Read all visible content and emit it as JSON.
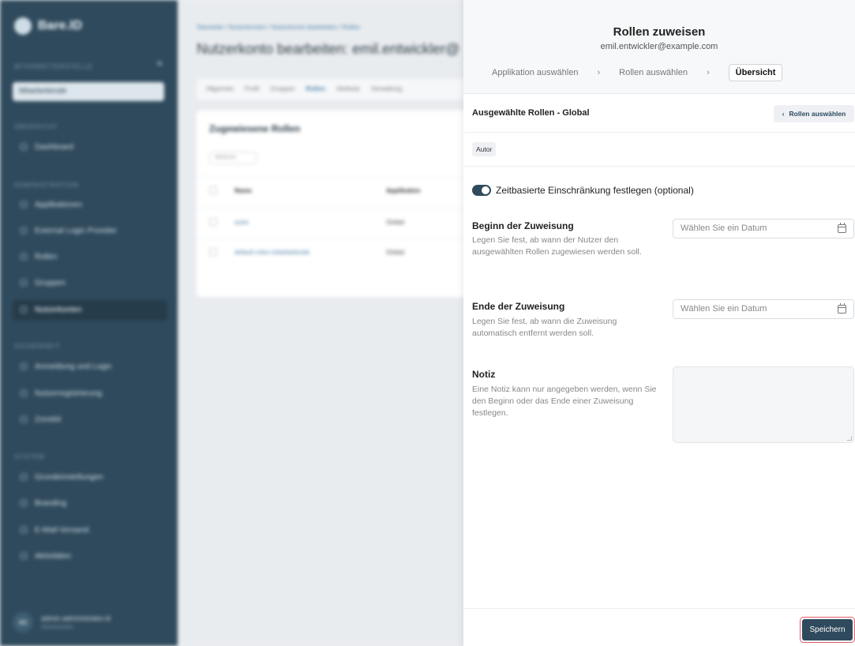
{
  "background": {
    "brand": "Bare.ID",
    "sidebar": {
      "section_tenant": "Mitarbeiterstelle",
      "tenant_select": "Mitarbeitende",
      "section_overview": "Übersicht",
      "dashboard": "Dashboard",
      "section_admin": "Administration",
      "admin_items": [
        "Applikationen",
        "External Login Provider",
        "Rollen",
        "Gruppen",
        "Nutzerkonten"
      ],
      "section_security": "Sicherheit",
      "security_items": [
        "Anmeldung und Login",
        "Nutzerregistrierung",
        "Zonebit"
      ],
      "section_system": "System",
      "system_items": [
        "Grundeinstellungen",
        "Branding",
        "E-Mail-Versand",
        "Aktivitäten"
      ],
      "user_name": "admin.administrator.id",
      "user_role": "Administrator",
      "user_initials": "AD"
    },
    "breadcrumb": "Startseite / Nutzerkonten / Nutzerkonto bearbeiten / Rollen",
    "page_title": "Nutzerkonto bearbeiten: emil.entwickler@",
    "tabs": [
      "Allgemein",
      "Profil",
      "Gruppen",
      "Rollen",
      "Attribute",
      "Verwaltung"
    ],
    "card_title": "Zugewiesene Rollen",
    "filter": "Aktionen",
    "col_name": "Name",
    "col_app": "Applikation",
    "rows": [
      {
        "name": "autor",
        "app": "Global"
      },
      {
        "name": "default-roles-mitarbeitende",
        "app": "Global"
      }
    ]
  },
  "drawer": {
    "title": "Rollen zuweisen",
    "subtitle": "emil.entwickler@example.com",
    "steps": {
      "step1": "Applikation auswählen",
      "sep1": "›",
      "step2": "Rollen auswählen",
      "sep2": "›",
      "step3": "Übersicht"
    },
    "selected_title": "Ausgewählte Rollen - Global",
    "back_button": "Rollen auswählen",
    "back_chevron": "‹",
    "roles": [
      "Autor"
    ],
    "toggle": {
      "label": "Zeitbasierte Einschränkung festlegen (optional)",
      "on": true
    },
    "begin": {
      "label": "Beginn der Zuweisung",
      "description": "Legen Sie fest, ab wann der Nutzer den ausgewählten Rollen zugewiesen werden soll.",
      "placeholder": "Wählen Sie ein Datum"
    },
    "end": {
      "label": "Ende der Zuweisung",
      "description": "Legen Sie fest, ab wann die Zuweisung automatisch entfernt werden soll.",
      "placeholder": "Wählen Sie ein Datum"
    },
    "note": {
      "label": "Notiz",
      "description": "Eine Notiz kann nur angegeben werden, wenn Sie den Beginn oder das Ende einer Zuweisung festlegen."
    },
    "save_button": "Speichern"
  },
  "colors": {
    "sidebar": "#2f4a5c",
    "primary": "#2f4a5c",
    "focus_ring": "#e05a6a"
  }
}
